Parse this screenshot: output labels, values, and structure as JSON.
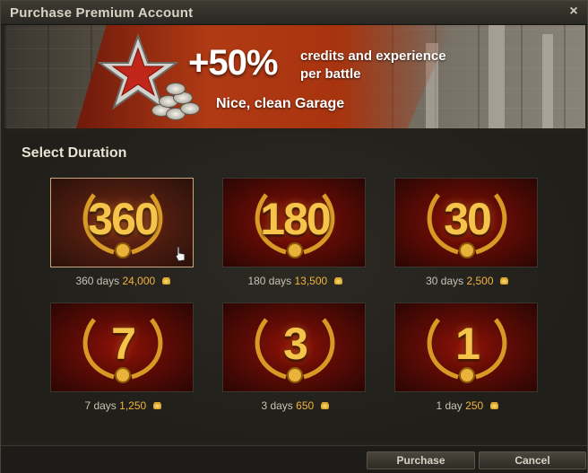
{
  "window": {
    "title": "Purchase Premium Account",
    "close_icon": "×"
  },
  "banner": {
    "percent": "+50%",
    "line1": "credits and experience",
    "line2": "per battle",
    "subtitle": "Nice, clean Garage"
  },
  "section": {
    "title": "Select Duration"
  },
  "options": [
    {
      "number": "360",
      "days": "360 days",
      "price": "24,000",
      "selected": true
    },
    {
      "number": "180",
      "days": "180 days",
      "price": "13,500",
      "selected": false
    },
    {
      "number": "30",
      "days": "30 days",
      "price": "2,500",
      "selected": false
    },
    {
      "number": "7",
      "days": "7 days",
      "price": "1,250",
      "selected": false
    },
    {
      "number": "3",
      "days": "3 days",
      "price": "650",
      "selected": false
    },
    {
      "number": "1",
      "days": "1 day",
      "price": "250",
      "selected": false
    }
  ],
  "buttons": {
    "purchase": "Purchase",
    "cancel": "Cancel"
  },
  "colors": {
    "accent_gold": "#f2b33d",
    "card_red": "#8e1208",
    "selected_border": "#c8a778"
  }
}
